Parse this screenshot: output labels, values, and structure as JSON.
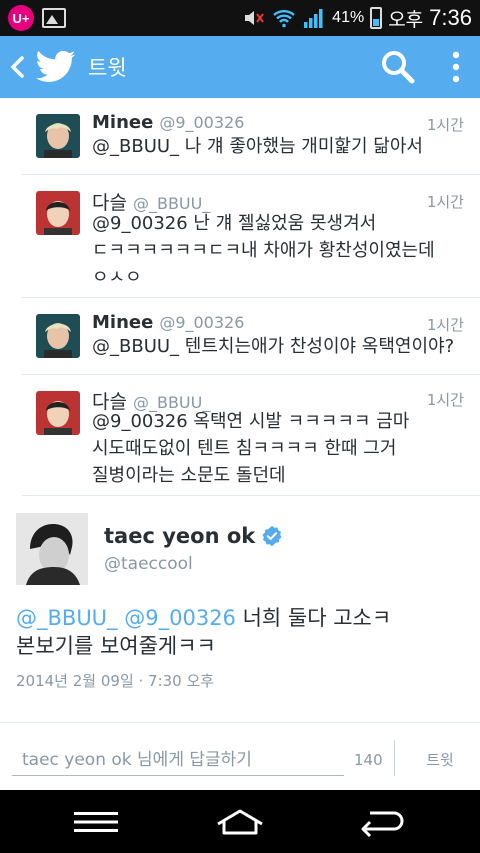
{
  "status_bar": {
    "carrier_logo": "U+",
    "battery_percent": "41%",
    "battery_level": 0.41,
    "ampm": "오후",
    "time": "7:36",
    "icons": [
      "uplus-logo",
      "gallery-icon",
      "mute-icon",
      "wifi-icon",
      "signal-icon",
      "battery-icon"
    ]
  },
  "action_bar": {
    "title": "트윗",
    "accent_color": "#55acee",
    "icons": [
      "back-icon",
      "twitter-bird-icon",
      "search-icon",
      "overflow-menu-icon"
    ]
  },
  "conversation": [
    {
      "name": "Minee",
      "handle": "@9_00326",
      "time": "1시간",
      "lines": [
        "@_BBUU_ 나 걔 좋아했늠 개미핥기 닮아서"
      ]
    },
    {
      "name": "다슬",
      "handle": "@_BBUU_",
      "time": "1시간",
      "lines": [
        "@9_00326 난 걔 젤싫었움 못생겨서",
        "ㄷㅋㅋㅋㅋㅋㅋㄷㅋ내 차애가 황찬성이였는데",
        "ㅇㅅㅇ"
      ]
    },
    {
      "name": "Minee",
      "handle": "@9_00326",
      "time": "1시간",
      "lines": [
        "@_BBUU_ 텐트치는애가 찬성이야 옥택연이야?"
      ]
    },
    {
      "name": "다슬",
      "handle": "@_BBUU_",
      "time": "1시간",
      "lines": [
        "@9_00326 옥택연 시발 ㅋㅋㅋㅋㅋ 금마",
        "시도때도없이 텐트 침ㅋㅋㅋㅋ 한때 그거",
        "질병이라는 소문도 돌던데"
      ]
    }
  ],
  "main_tweet": {
    "name": "taec yeon ok",
    "handle": "@taeccool",
    "mention1": "@_BBUU_",
    "mention2": "@9_00326",
    "text_line1_rest": " 너희 둘다 고소ㅋ",
    "text_line2": "본보기를 보여줄게ㅋㅋ",
    "date": "2014년 2월 09일 · 7:30 오후"
  },
  "reply": {
    "placeholder": "taec yeon ok 님에게 답글하기",
    "char_count": "140",
    "button_label": "트윗"
  },
  "nav_bar": {
    "icons": [
      "menu-icon",
      "home-icon",
      "back-nav-icon"
    ]
  }
}
